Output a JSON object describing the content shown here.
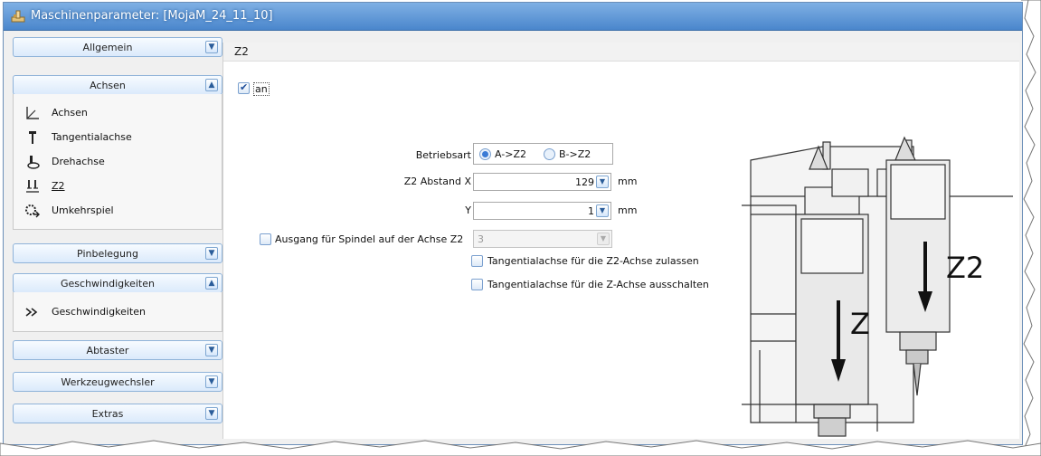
{
  "window": {
    "title": "Maschinenparameter: [MojaM_24_11_10]",
    "title_icon": "machine-icon"
  },
  "sidebar": {
    "panels": [
      {
        "label": "Allgemein",
        "chevron": "▼",
        "expanded": false
      },
      {
        "label": "Achsen",
        "chevron": "▲",
        "expanded": true,
        "items": [
          {
            "label": "Achsen",
            "icon": "axes-icon"
          },
          {
            "label": "Tangentialachse",
            "icon": "tangential-axis-icon"
          },
          {
            "label": "Drehachse",
            "icon": "rotary-axis-icon"
          },
          {
            "label": "Z2",
            "icon": "z2-icon",
            "selected": true
          },
          {
            "label": "Umkehrspiel",
            "icon": "backlash-icon"
          }
        ]
      },
      {
        "label": "Pinbelegung",
        "chevron": "▼",
        "expanded": false
      },
      {
        "label": "Geschwindigkeiten",
        "chevron": "▲",
        "expanded": true,
        "items": [
          {
            "label": "Geschwindigkeiten",
            "icon": "speed-icon"
          }
        ]
      },
      {
        "label": "Abtaster",
        "chevron": "▼",
        "expanded": false
      },
      {
        "label": "Werkzeugwechsler",
        "chevron": "▼",
        "expanded": false
      },
      {
        "label": "Extras",
        "chevron": "▼",
        "expanded": false
      }
    ]
  },
  "content": {
    "header": "Z2",
    "enabled_checkbox": {
      "label": "an",
      "checked": true
    },
    "betriebsart": {
      "label": "Betriebsart",
      "options": [
        {
          "label": "A->Z2",
          "checked": true
        },
        {
          "label": "B->Z2",
          "checked": false
        }
      ]
    },
    "abstand_x": {
      "label": "Z2 Abstand X",
      "value": "129",
      "unit": "mm"
    },
    "abstand_y": {
      "label": "Y",
      "value": "1",
      "unit": "mm"
    },
    "spindle_output": {
      "label": "Ausgang für Spindel auf der Achse Z2",
      "checked": false,
      "value": "3"
    },
    "tangential_z2": {
      "label": "Tangentialachse für die Z2-Achse zulassen",
      "checked": false
    },
    "tangential_z": {
      "label": "Tangentialachse für die Z-Achse ausschalten",
      "checked": false
    },
    "illustration": {
      "label_z": "Z",
      "label_z2": "Z2"
    }
  }
}
